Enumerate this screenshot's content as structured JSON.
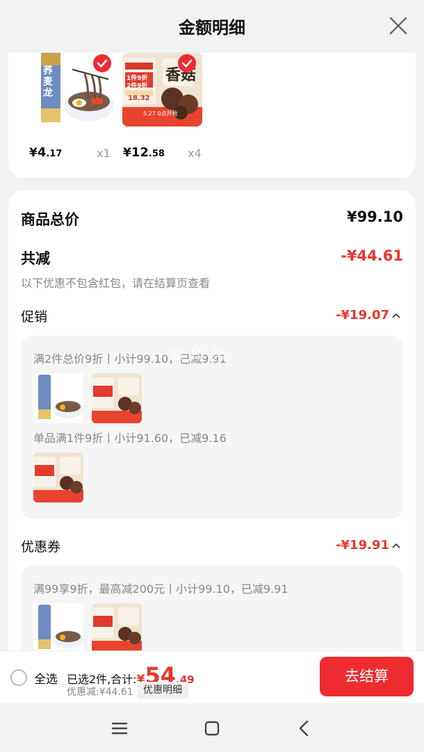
{
  "header": {
    "title": "金额明细"
  },
  "products": [
    {
      "price_symbol": "¥",
      "price_int": "4",
      "price_dec": ".17",
      "qty": "x1",
      "name": "荞麦龙须面"
    },
    {
      "price_symbol": "¥",
      "price_int": "12",
      "price_dec": ".58",
      "qty": "x4",
      "name": "香菇"
    }
  ],
  "summary": {
    "total_label": "商品总价",
    "total_value": "¥99.10",
    "reduce_label": "共减",
    "reduce_value": "-¥44.61",
    "note": "以下优惠不包含红包，请在结算页查看"
  },
  "promotion": {
    "label": "促销",
    "value": "-¥19.07",
    "lines": [
      "满2件总价9折丨小计99.10，已减9.91",
      "单品满1件9折丨小计91.60，已减9.16"
    ]
  },
  "coupon": {
    "label": "优惠券",
    "value": "-¥19.91",
    "lines": [
      "满99享9折，最高减200元丨小计99.10，已减9.91"
    ]
  },
  "watermark": "狐 印 帮",
  "thumb_text": {
    "noodle_brand": "荞麦龙",
    "mushroom_title": "香菇",
    "promo1": "1件9折",
    "promo2": "2件9折",
    "price_tag": "18.32",
    "date_tag": "5.27 0点开抢"
  },
  "footer": {
    "select_all": "全选",
    "selected_text": "已选2件,合计:",
    "total_symbol": "¥",
    "total_int": "54",
    "total_dec": ".49",
    "discount_text": "优惠减:¥44.61",
    "detail_button": "优惠明细",
    "checkout_button": "去结算"
  },
  "colors": {
    "accent": "#e8352e",
    "checkout": "#ee2c2f"
  }
}
